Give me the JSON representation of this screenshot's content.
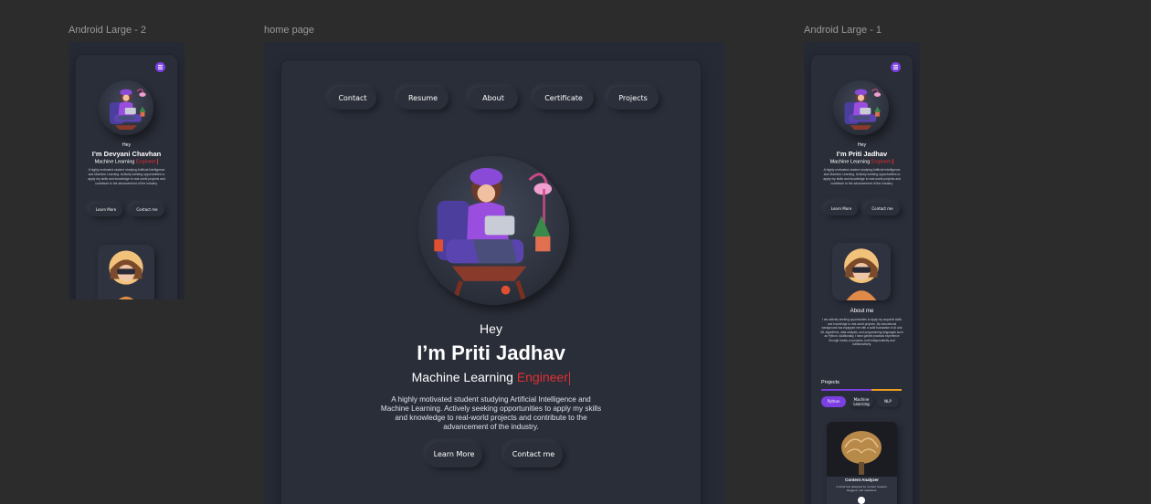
{
  "frames": {
    "left_label": "Android Large - 2",
    "center_label": "home page",
    "right_label": "Android Large - 1"
  },
  "center": {
    "nav": [
      "Contact",
      "Resume",
      "About",
      "Certificate",
      "Projects"
    ],
    "greeting": "Hey",
    "name": "I’m Priti Jadhav",
    "role_prefix": "Machine Learning ",
    "role_accent": "Engineer",
    "bio": "A highly motivated student studying Artificial Intelligence and Machine Learning. Actively seeking opportunities to apply my skills and knowledge to real-world projects and contribute to the advancement of the industry.",
    "learn_more": "Learn More",
    "contact_me": "Contact me"
  },
  "left": {
    "greeting": "Hey",
    "name": "I’m Devyani Chavhan",
    "role_prefix": "Machine Learning ",
    "role_accent": "Engineer",
    "bio": "A highly motivated student studying Artificial Intelligence and Machine Learning. Actively seeking opportunities to apply my skills and knowledge to real-world projects and contribute to the advancement of the industry.",
    "learn_more": "Learn More",
    "contact_me": "Contact me"
  },
  "right": {
    "greeting": "Hey",
    "name": "I’m Priti Jadhav",
    "role_prefix": "Machine Learning ",
    "role_accent": "Engineer",
    "bio": "A highly motivated student studying Artificial Intelligence and Machine Learning. Actively seeking opportunities to apply my skills and knowledge to real-world projects and contribute to the advancement of the industry.",
    "learn_more": "Learn More",
    "contact_me": "Contact me",
    "about_title": "About me",
    "about_text": "I am actively seeking opportunities to apply my acquired skills and knowledge to real-world projects. My educational background has equipped me with a solid foundation in AI and ML algorithms, data analysis, and programming languages such as Python. Additionally, I have gained practical experience through hands-on projects, both independently and collaboratively.",
    "projects_title": "Projects",
    "chips": [
      "Python",
      "Machine Learning",
      "NLP"
    ],
    "project_card_title": "Content Analyzer",
    "project_card_desc": "A cloud tool designed for content creators, bloggers, and marketers."
  },
  "colors": {
    "accent_red": "#e03131",
    "accent_purple": "#7b3fe4",
    "progress_orange": "#f0a020",
    "canvas": "#2c2c2c",
    "frame_bg": "#2a2e39"
  }
}
